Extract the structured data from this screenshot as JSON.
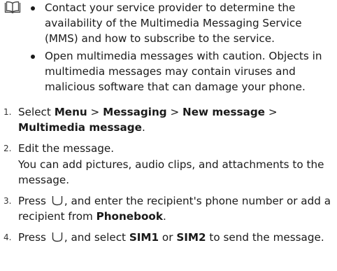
{
  "note": {
    "icon": "book-icon",
    "bullets": [
      "Contact your service provider to determine the availability of the Multimedia Messaging Service (MMS) and how to subscribe to the service.",
      "Open multimedia messages with caution. Objects in multimedia messages may contain viruses and malicious software that can damage your phone."
    ]
  },
  "steps": [
    {
      "number": "1.",
      "t1": "Select ",
      "b1": "Menu",
      "t2": " > ",
      "b2": "Messaging",
      "t3": " > ",
      "b3": "New message",
      "t4": " > ",
      "b4": "Multimedia message",
      "t5": "."
    },
    {
      "number": "2.",
      "line1": "Edit the message.",
      "line2": "You can add pictures, audio clips, and attachments to the message."
    },
    {
      "number": "3.",
      "t1": "Press ",
      "icon": "call-key-icon",
      "t2": ", and enter the recipient's phone number or add a recipient from ",
      "b1": "Phonebook",
      "t3": "."
    },
    {
      "number": "4.",
      "t1": "Press ",
      "icon": "call-key-icon",
      "t2": ", and select ",
      "b1": "SIM1",
      "t3": " or ",
      "b2": "SIM2",
      "t4": " to send the message."
    }
  ]
}
